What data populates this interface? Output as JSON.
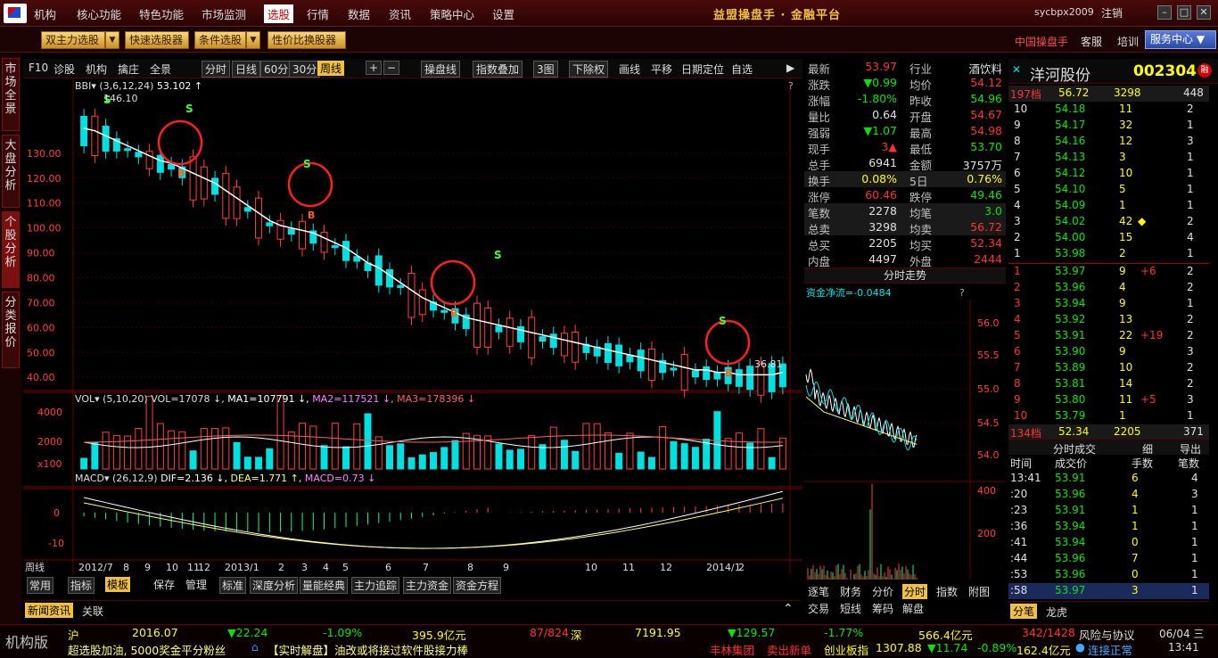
{
  "menu": {
    "items": [
      "机构",
      "核心功能",
      "特色功能",
      "市场监测",
      "选股",
      "行情",
      "数据",
      "资讯",
      "策略中心",
      "设置"
    ],
    "active": "选股"
  },
  "app_title": "益盟操盘手 · 金融平台",
  "user": "sycbpx2009",
  "logout": "注销",
  "toolbar": {
    "buttons": [
      "双主力选股",
      "快速选股器",
      "条件选股",
      "性价比换股器"
    ],
    "right_links": [
      "中国操盘手",
      "客服",
      "培训"
    ],
    "service": "服务中心"
  },
  "left_tabs": [
    "市场全景",
    "大盘分析",
    "个股分析",
    "分类报价"
  ],
  "chart_toolbar": [
    "F10",
    "诊股",
    "机构",
    "擒庄",
    "全景",
    "分时",
    "日线",
    "60分",
    "30分",
    "周线",
    "操盘线",
    "指数叠加",
    "3图",
    "下除权",
    "画线",
    "平移",
    "日期定位",
    "自选"
  ],
  "main_indicator": {
    "name": "BBI",
    "params": "(3,6,12,24)",
    "value": "53.102",
    "high_label": "146.10",
    "low_label": "36.81",
    "y_ticks": [
      "130.00",
      "120.00",
      "110.00",
      "100.00",
      "90.00",
      "80.00",
      "70.00",
      "60.00",
      "50.00",
      "40.00"
    ]
  },
  "vol_indicator": {
    "name": "VOL",
    "params": "(5,10,20)",
    "vol": "VOL=17078",
    "ma1": "MA1=107791",
    "ma2": "MA2=117521",
    "ma3": "MA3=178396",
    "y_ticks": [
      "4000",
      "2000",
      "x100"
    ]
  },
  "macd_indicator": {
    "name": "MACD",
    "params": "(26,12,9)",
    "dif": "DIF=2.136",
    "dea": "DEA=1.771",
    "macd": "MACD=0.73",
    "y_ticks": [
      "0",
      "-10"
    ]
  },
  "x_axis": {
    "label": "周线",
    "ticks": [
      "2012/7",
      "8",
      "9",
      "10",
      "11",
      "12",
      "2013/1",
      "2",
      "3",
      "4",
      "5",
      "6",
      "7",
      "8",
      "9",
      "10",
      "11",
      "12",
      "2014/1",
      "2"
    ]
  },
  "bottom_tabs": [
    "常用",
    "指标",
    "模板",
    "保存",
    "管理",
    "标准",
    "深度分析",
    "量能经典",
    "主力追踪",
    "主力资金",
    "资金方程"
  ],
  "news_tabs": [
    "新闻资讯",
    "关联"
  ],
  "quote": {
    "rows": [
      [
        "最新",
        "53.97",
        "行业",
        "酒饮料"
      ],
      [
        "涨跌",
        "▼0.99",
        "均价",
        "54.12"
      ],
      [
        "涨幅",
        "-1.80%",
        "昨收",
        "54.96"
      ],
      [
        "量比",
        "0.64",
        "开盘",
        "54.67"
      ],
      [
        "强弱",
        "▼1.07",
        "最高",
        "54.98"
      ],
      [
        "现手",
        "3▲",
        "最低",
        "53.70"
      ],
      [
        "总手",
        "6941",
        "金额",
        "3757万"
      ],
      [
        "换手",
        "0.08%",
        "5日",
        "0.76%"
      ],
      [
        "涨停",
        "60.46",
        "跌停",
        "49.46"
      ],
      [
        "笔数",
        "2278",
        "均笔",
        "3.0"
      ],
      [
        "总卖",
        "3298",
        "均卖",
        "56.72"
      ],
      [
        "总买",
        "2205",
        "均买",
        "52.34"
      ],
      [
        "内盘",
        "4497",
        "外盘",
        "2444"
      ]
    ]
  },
  "mini_chart": {
    "title": "分时走势",
    "flow": "资金净流=-0.0484",
    "y_ticks": [
      "56.0",
      "55.5",
      "55.0",
      "54.5",
      "54.0"
    ],
    "vol_ticks": [
      "400",
      "200"
    ]
  },
  "mini_tabs": [
    "逐笔",
    "财务",
    "分价",
    "分时",
    "指数",
    "附图",
    "交易",
    "短线",
    "筹码",
    "解盘"
  ],
  "stock": {
    "name": "洋河股份",
    "code": "002304"
  },
  "sell_summary": {
    "label": "197档",
    "price": "56.72",
    "vol": "3298",
    "count": "448"
  },
  "sells": [
    [
      "10",
      "54.18",
      "11",
      "",
      "2"
    ],
    [
      "9",
      "54.17",
      "32",
      "",
      "1"
    ],
    [
      "8",
      "54.16",
      "12",
      "",
      "3"
    ],
    [
      "7",
      "54.13",
      "3",
      "",
      "1"
    ],
    [
      "6",
      "54.12",
      "10",
      "",
      "1"
    ],
    [
      "5",
      "54.10",
      "5",
      "",
      "1"
    ],
    [
      "4",
      "54.09",
      "1",
      "",
      "1"
    ],
    [
      "3",
      "54.02",
      "42",
      "◆",
      "2"
    ],
    [
      "2",
      "54.00",
      "15",
      "",
      "4"
    ],
    [
      "1",
      "53.98",
      "2",
      "",
      "1"
    ]
  ],
  "buys": [
    [
      "1",
      "53.97",
      "9",
      "+6",
      "2"
    ],
    [
      "2",
      "53.96",
      "4",
      "",
      "2"
    ],
    [
      "3",
      "53.94",
      "9",
      "",
      "1"
    ],
    [
      "4",
      "53.92",
      "13",
      "",
      "2"
    ],
    [
      "5",
      "53.91",
      "22",
      "+19",
      "2"
    ],
    [
      "6",
      "53.90",
      "9",
      "",
      "3"
    ],
    [
      "7",
      "53.89",
      "10",
      "",
      "2"
    ],
    [
      "8",
      "53.81",
      "14",
      "",
      "2"
    ],
    [
      "9",
      "53.80",
      "11",
      "+5",
      "3"
    ],
    [
      "10",
      "53.79",
      "1",
      "",
      "1"
    ]
  ],
  "buy_summary": {
    "label": "134档",
    "price": "52.34",
    "vol": "2205",
    "count": "371"
  },
  "trades_header": {
    "title": "分时成交",
    "detail": "细",
    "export": "导出",
    "cols": [
      "时间",
      "成交价",
      "手数",
      "笔数"
    ]
  },
  "trades": [
    [
      "13:41",
      "53.91",
      "6",
      "4"
    ],
    [
      ":20",
      "53.96",
      "4",
      "3"
    ],
    [
      ":23",
      "53.91",
      "1",
      "1"
    ],
    [
      ":36",
      "53.94",
      "1",
      "1"
    ],
    [
      ":41",
      "53.94",
      "0",
      "1"
    ],
    [
      ":44",
      "53.96",
      "7",
      "1"
    ],
    [
      ":53",
      "53.96",
      "0",
      "1"
    ],
    [
      ":58",
      "53.97",
      "3",
      "1"
    ]
  ],
  "order_tabs": [
    "分笔",
    "龙虎"
  ],
  "ticker": {
    "brand": "机构版",
    "sh_label": "沪",
    "sh_index": "2016.07",
    "sh_chg": "▼22.24",
    "sh_pct": "-1.09%",
    "sh_amt": "395.9亿元",
    "sh_ud": "87/824",
    "sz_label": "深",
    "sz_index": "7191.95",
    "sz_chg": "▼129.57",
    "sz_pct": "-1.77%",
    "sz_amt": "566.4亿元",
    "sz_ud": "342/1428",
    "risk": "风险与协议",
    "date": "06/04 三",
    "time": "13:41",
    "scroll": "超选股加油, 5000奖金平分粉丝",
    "news": "【实时解盘】油改或将接过软件股接力棒",
    "stock2": "丰林集团",
    "stock2_msg": "卖出新单",
    "board": "创业板指",
    "board_val": "1307.88",
    "board_chg": "▼11.74",
    "board_pct": "-0.89%",
    "board_amt": "162.4亿元",
    "conn": "连接正常"
  },
  "chart_data": {
    "type": "candlestick",
    "title": "",
    "series": [
      {
        "name": "BBI",
        "values": [
          140,
          139,
          137,
          135,
          133,
          131,
          129,
          127,
          126,
          124,
          122,
          120,
          118,
          115,
          112,
          109,
          106,
          103,
          101,
          100,
          99,
          98,
          96,
          94,
          92,
          89,
          86,
          84,
          81,
          78,
          75,
          72,
          70,
          68,
          66,
          64,
          63,
          62,
          61,
          60,
          59,
          58,
          57,
          56,
          55,
          54,
          53,
          52,
          51,
          50,
          49,
          48,
          47,
          46,
          45,
          44,
          43,
          43,
          42,
          42,
          41,
          41,
          41,
          41,
          42
        ]
      }
    ]
  }
}
